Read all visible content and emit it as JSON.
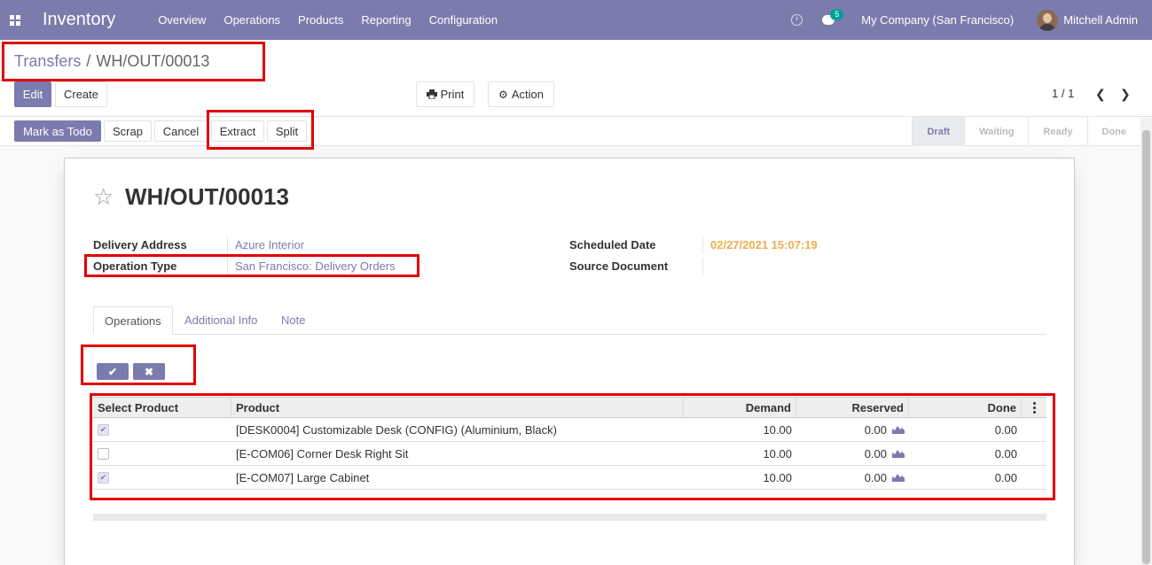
{
  "navbar": {
    "app_title": "Inventory",
    "menu": [
      "Overview",
      "Operations",
      "Products",
      "Reporting",
      "Configuration"
    ],
    "chat_count": "5",
    "company": "My Company (San Francisco)",
    "user": "Mitchell Admin"
  },
  "breadcrumb": {
    "parent": "Transfers",
    "separator": "/",
    "current": "WH/OUT/00013"
  },
  "buttons": {
    "edit": "Edit",
    "create": "Create",
    "print": "Print",
    "action": "Action",
    "mark_todo": "Mark as Todo",
    "scrap": "Scrap",
    "cancel": "Cancel",
    "extract": "Extract",
    "split": "Split"
  },
  "pager": {
    "value": "1 / 1"
  },
  "stages": [
    "Draft",
    "Waiting",
    "Ready",
    "Done"
  ],
  "record": {
    "title": "WH/OUT/00013",
    "delivery_address_label": "Delivery Address",
    "delivery_address": "Azure Interior",
    "operation_type_label": "Operation Type",
    "operation_type": "San Francisco: Delivery Orders",
    "scheduled_date_label": "Scheduled Date",
    "scheduled_date": "02/27/2021 15:07:19",
    "source_document_label": "Source Document",
    "source_document": ""
  },
  "tabs": [
    "Operations",
    "Additional Info",
    "Note"
  ],
  "table": {
    "columns": [
      "Select Product",
      "Product",
      "Demand",
      "Reserved",
      "Done"
    ],
    "rows": [
      {
        "selected": true,
        "product": "[DESK0004] Customizable Desk (CONFIG) (Aluminium, Black)",
        "demand": "10.00",
        "reserved": "0.00",
        "done": "0.00"
      },
      {
        "selected": false,
        "product": "[E-COM06] Corner Desk Right Sit",
        "demand": "10.00",
        "reserved": "0.00",
        "done": "0.00"
      },
      {
        "selected": true,
        "product": "[E-COM07] Large Cabinet",
        "demand": "10.00",
        "reserved": "0.00",
        "done": "0.00"
      }
    ]
  },
  "colors": {
    "primary": "#7c7bad",
    "highlight": "#e00000",
    "date": "#f0ad4e"
  }
}
